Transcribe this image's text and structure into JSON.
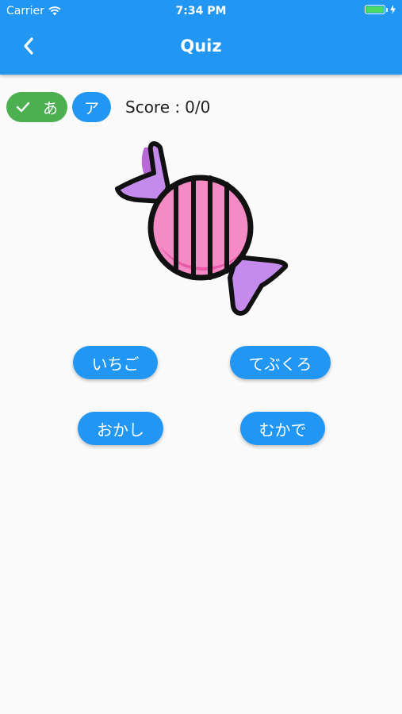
{
  "status_bar": {
    "carrier": "Carrier",
    "time": "7:34 PM"
  },
  "app_bar": {
    "title": "Quiz",
    "back_icon": "chevron-left-icon",
    "color": "#2196f3"
  },
  "mode_toggle": {
    "hiragana": {
      "label": "あ",
      "selected": true,
      "icon": "check-icon",
      "color": "#4caf50"
    },
    "katakana": {
      "label": "ア",
      "selected": false,
      "color": "#2196f3"
    }
  },
  "score": {
    "label": "Score :",
    "value": "0/0"
  },
  "quiz_image": {
    "icon": "candy-icon"
  },
  "answers": [
    "いちご",
    "てぶくろ",
    "おかし",
    "むかで"
  ]
}
